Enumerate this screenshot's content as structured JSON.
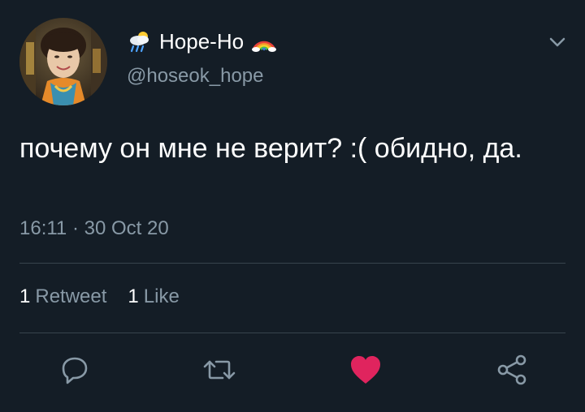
{
  "user": {
    "display_name": "Hope-Ho",
    "handle": "@hoseok_hope",
    "name_prefix_icon": "cloud-rain-sun-icon",
    "name_suffix_icon": "rainbow-icon"
  },
  "tweet": {
    "text": "почему он мне не верит? :( обидно, да.",
    "timestamp": "16:11 · 30 Oct 20"
  },
  "stats": {
    "retweets_count": "1",
    "retweets_label": "Retweet",
    "likes_count": "1",
    "likes_label": "Like"
  },
  "actions": {
    "reply_icon": "reply-icon",
    "retweet_icon": "retweet-icon",
    "like_icon": "heart-icon",
    "share_icon": "share-icon",
    "like_active": true
  },
  "colors": {
    "background": "#141d26",
    "text_primary": "#ffffff",
    "text_secondary": "#8899a6",
    "divider": "#38444d",
    "like": "#e0245e",
    "icon": "#8899a6"
  }
}
